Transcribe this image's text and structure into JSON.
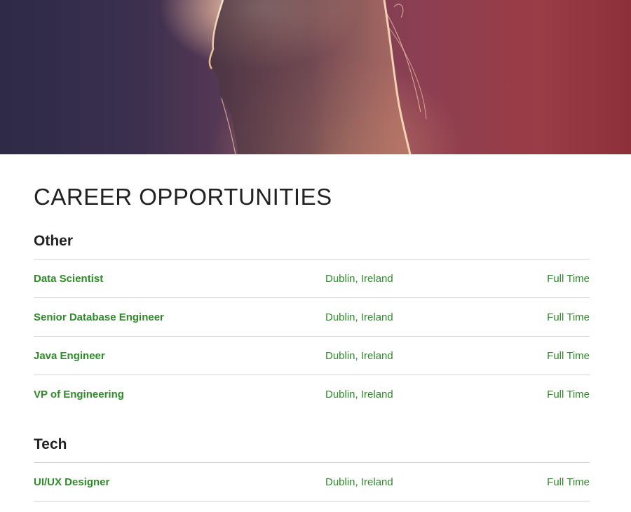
{
  "page": {
    "title": "CAREER OPPORTUNITIES"
  },
  "sections": [
    {
      "heading": "Other",
      "jobs": [
        {
          "title": "Data Scientist",
          "location": "Dublin, Ireland",
          "type": "Full Time"
        },
        {
          "title": "Senior Database Engineer",
          "location": "Dublin, Ireland",
          "type": "Full Time"
        },
        {
          "title": "Java Engineer",
          "location": "Dublin, Ireland",
          "type": "Full Time"
        },
        {
          "title": "VP of Engineering",
          "location": "Dublin, Ireland",
          "type": "Full Time"
        }
      ]
    },
    {
      "heading": "Tech",
      "jobs": [
        {
          "title": "UI/UX Designer",
          "location": "Dublin, Ireland",
          "type": "Full Time"
        }
      ]
    }
  ],
  "colors": {
    "job_link": "#2f8a2a",
    "heading": "#222222",
    "divider": "#d3d3d3"
  }
}
